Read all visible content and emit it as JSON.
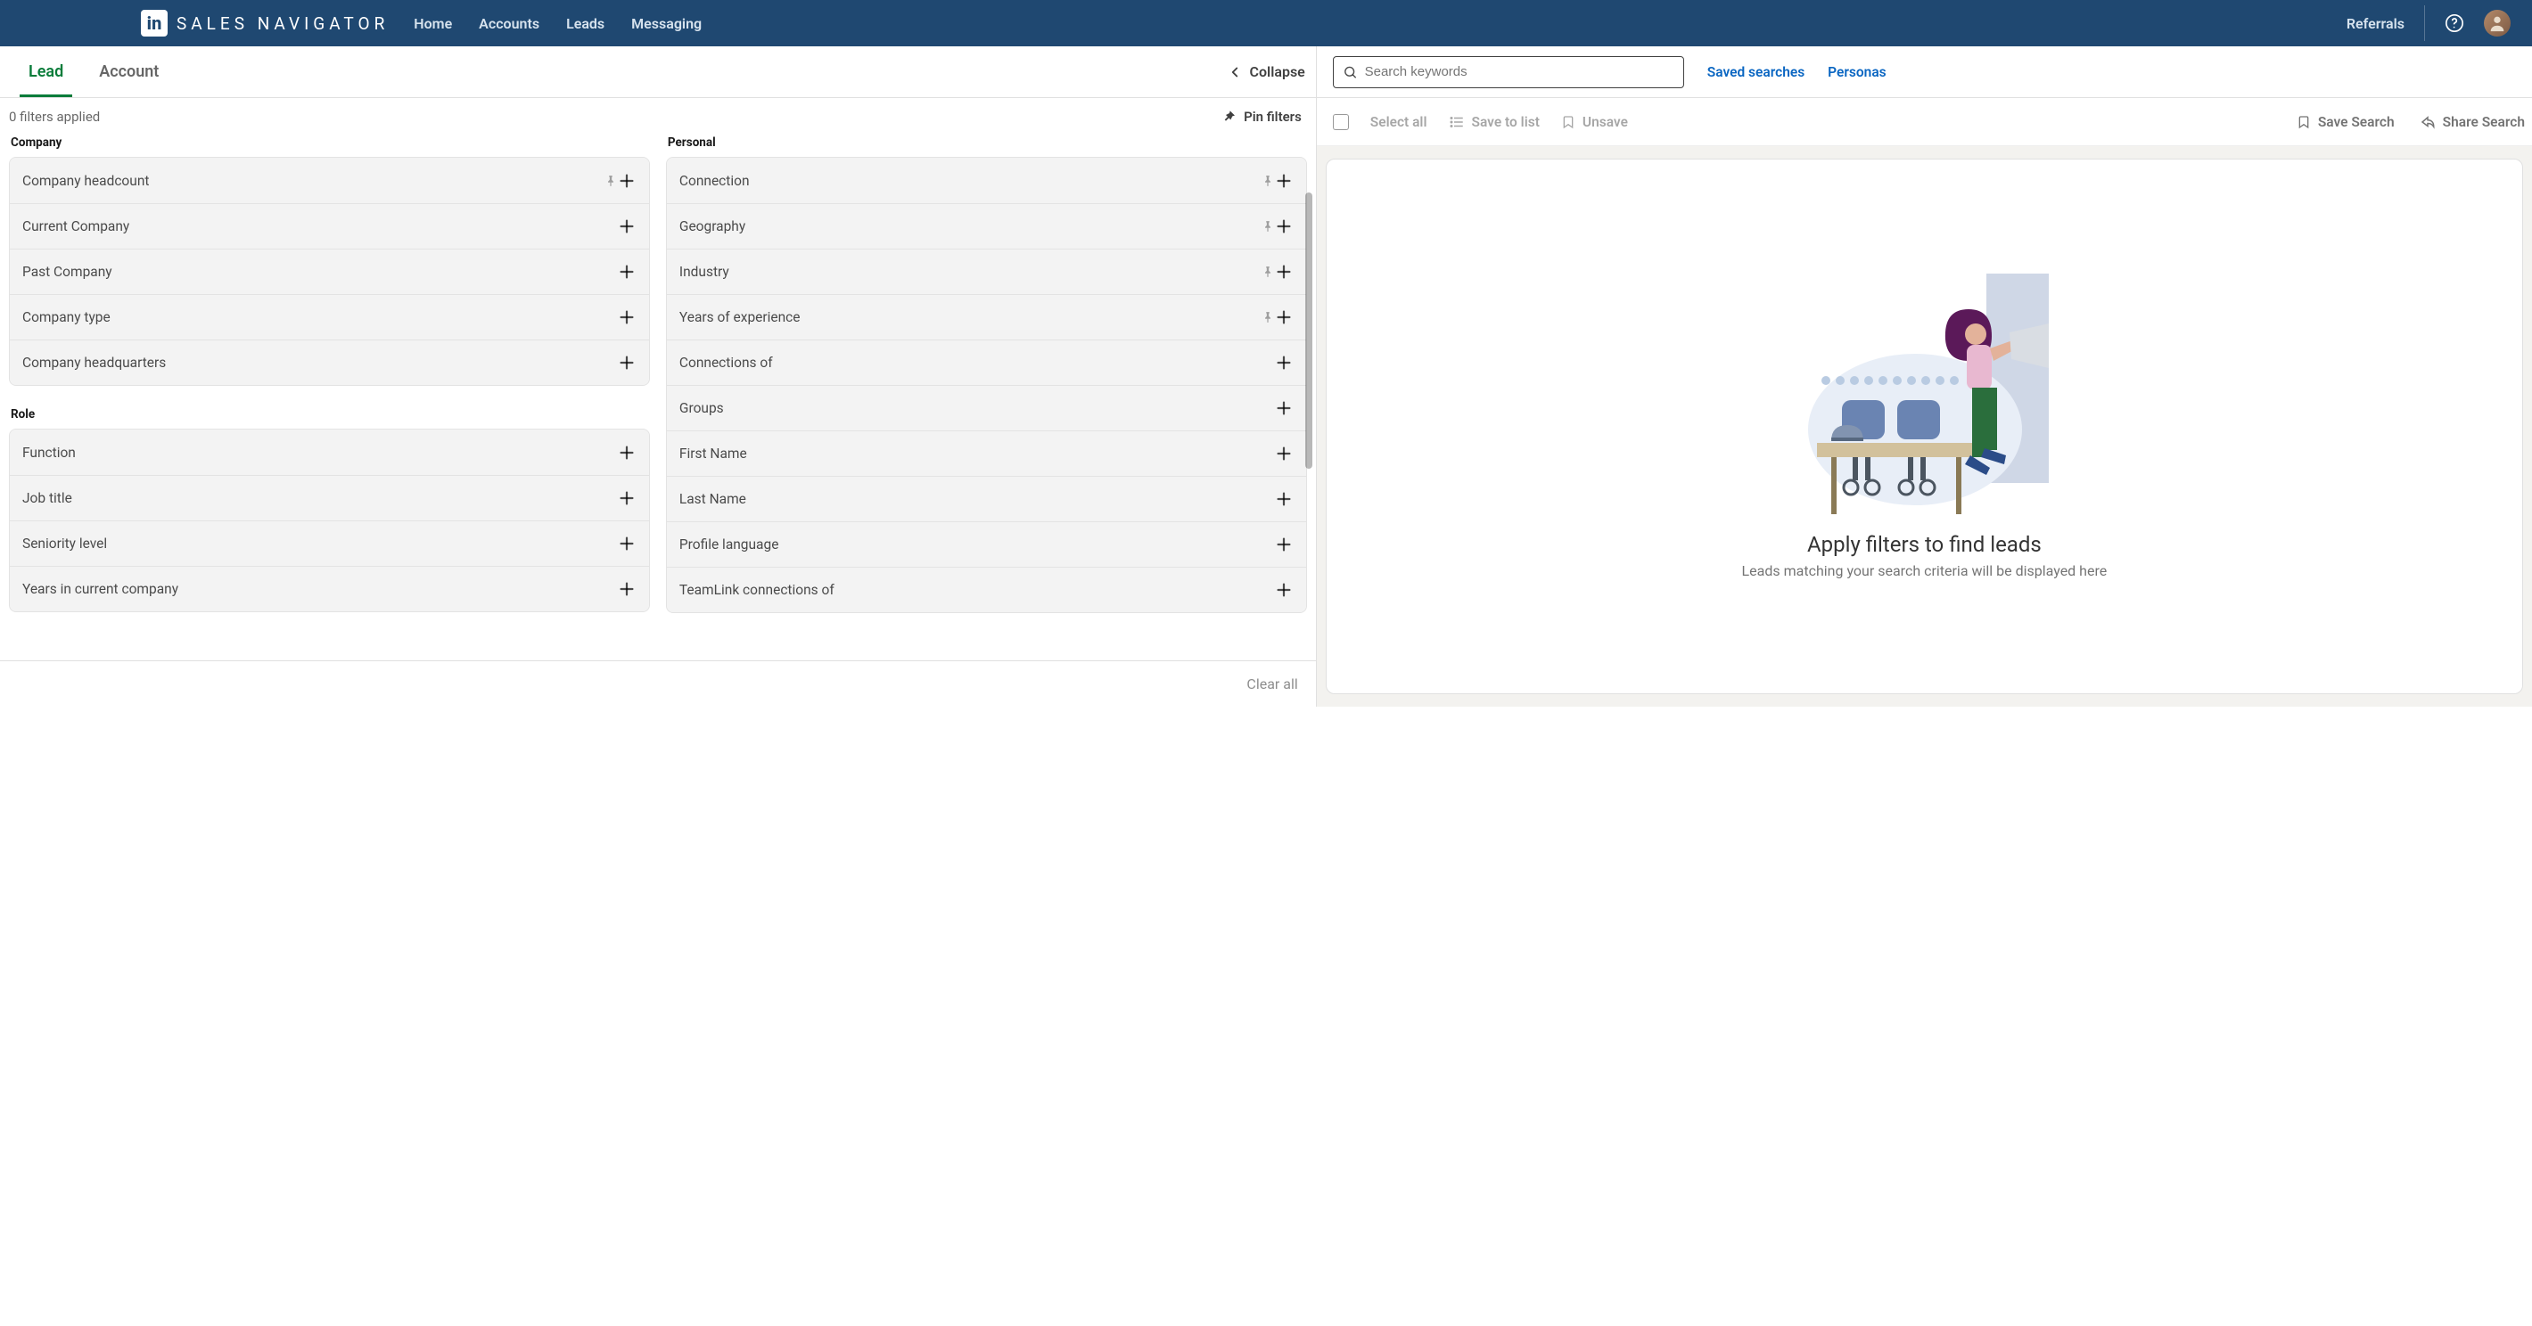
{
  "brand": {
    "logo_text": "in",
    "title": "SALES NAVIGATOR"
  },
  "nav": {
    "home": "Home",
    "accounts": "Accounts",
    "leads": "Leads",
    "messaging": "Messaging",
    "referrals": "Referrals"
  },
  "tabs": {
    "lead": "Lead",
    "account": "Account",
    "collapse": "Collapse"
  },
  "filters_header": {
    "applied": "0 filters applied",
    "pin": "Pin filters"
  },
  "sections": {
    "company": "Company",
    "role": "Role",
    "personal": "Personal"
  },
  "filters": {
    "company": [
      {
        "label": "Company headcount",
        "pinned": true
      },
      {
        "label": "Current Company",
        "pinned": false
      },
      {
        "label": "Past Company",
        "pinned": false
      },
      {
        "label": "Company type",
        "pinned": false
      },
      {
        "label": "Company headquarters",
        "pinned": false
      }
    ],
    "role": [
      {
        "label": "Function",
        "pinned": false
      },
      {
        "label": "Job title",
        "pinned": false
      },
      {
        "label": "Seniority level",
        "pinned": false
      },
      {
        "label": "Years in current company",
        "pinned": false
      }
    ],
    "personal": [
      {
        "label": "Connection",
        "pinned": true
      },
      {
        "label": "Geography",
        "pinned": true
      },
      {
        "label": "Industry",
        "pinned": true
      },
      {
        "label": "Years of experience",
        "pinned": true
      },
      {
        "label": "Connections of",
        "pinned": false
      },
      {
        "label": "Groups",
        "pinned": false
      },
      {
        "label": "First Name",
        "pinned": false
      },
      {
        "label": "Last Name",
        "pinned": false
      },
      {
        "label": "Profile language",
        "pinned": false
      },
      {
        "label": "TeamLink connections of",
        "pinned": false
      }
    ]
  },
  "clear_all": "Clear all",
  "search": {
    "placeholder": "Search keywords",
    "saved": "Saved searches",
    "personas": "Personas"
  },
  "toolbar": {
    "select_all": "Select all",
    "save_to_list": "Save to list",
    "unsave": "Unsave",
    "save_search": "Save Search",
    "share_search": "Share Search"
  },
  "empty": {
    "heading": "Apply filters to find leads",
    "sub": "Leads matching your search criteria will be displayed here"
  }
}
